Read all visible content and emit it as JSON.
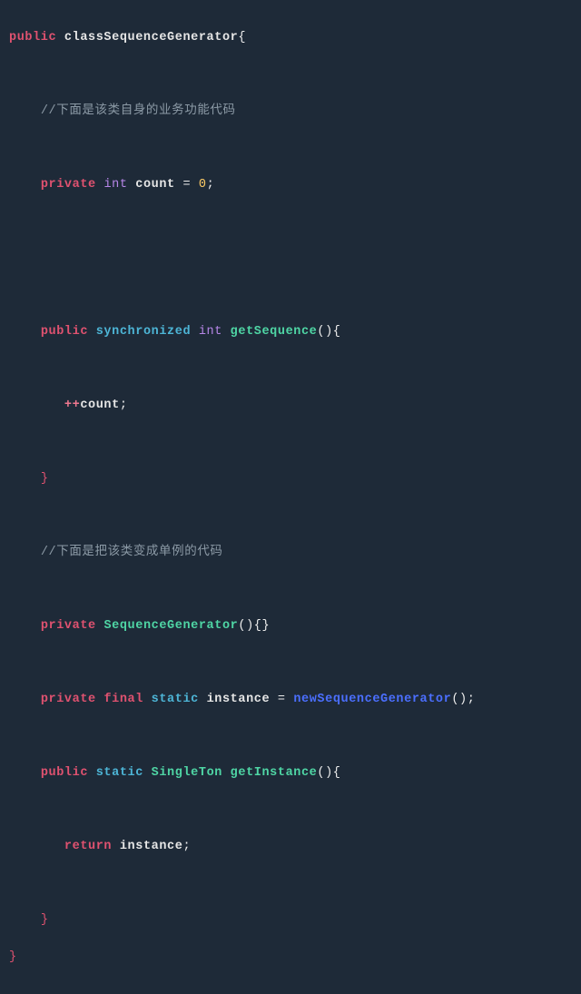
{
  "code": {
    "line1": {
      "public": "public",
      "class_decl": "classSequenceGenerator",
      "lb": "{"
    },
    "comment1": "//下面是该类自身的业务功能代码",
    "field": {
      "private": "private",
      "int": "int",
      "name": "count",
      "eq": "=",
      "val": "0",
      "semi": ";"
    },
    "method1": {
      "public": "public",
      "sync": "synchronized",
      "int": "int",
      "name": "getSequence",
      "lp": "(",
      "rp": ")",
      "lb": "{"
    },
    "m1_body": {
      "op": "++",
      "name": "count",
      "semi": ";"
    },
    "m1_close": "}",
    "comment2": "//下面是把该类变成单例的代码",
    "ctor": {
      "private": "private",
      "name": "SequenceGenerator",
      "lp": "(",
      "rp": ")",
      "lb": "{",
      "rb": "}"
    },
    "instance": {
      "private": "private",
      "final": "final",
      "static": "static",
      "name": "instance",
      "eq": "=",
      "new": "newSequenceGenerator",
      "lp": "(",
      "rp": ")",
      "semi": ";"
    },
    "method2": {
      "public": "public",
      "static": "static",
      "type": "SingleTon",
      "name": "getInstance",
      "lp": "(",
      "rp": ")",
      "lb": "{"
    },
    "m2_body": {
      "return": "return",
      "name": "instance",
      "semi": ";"
    },
    "m2_close": "}",
    "class_close": "}"
  }
}
